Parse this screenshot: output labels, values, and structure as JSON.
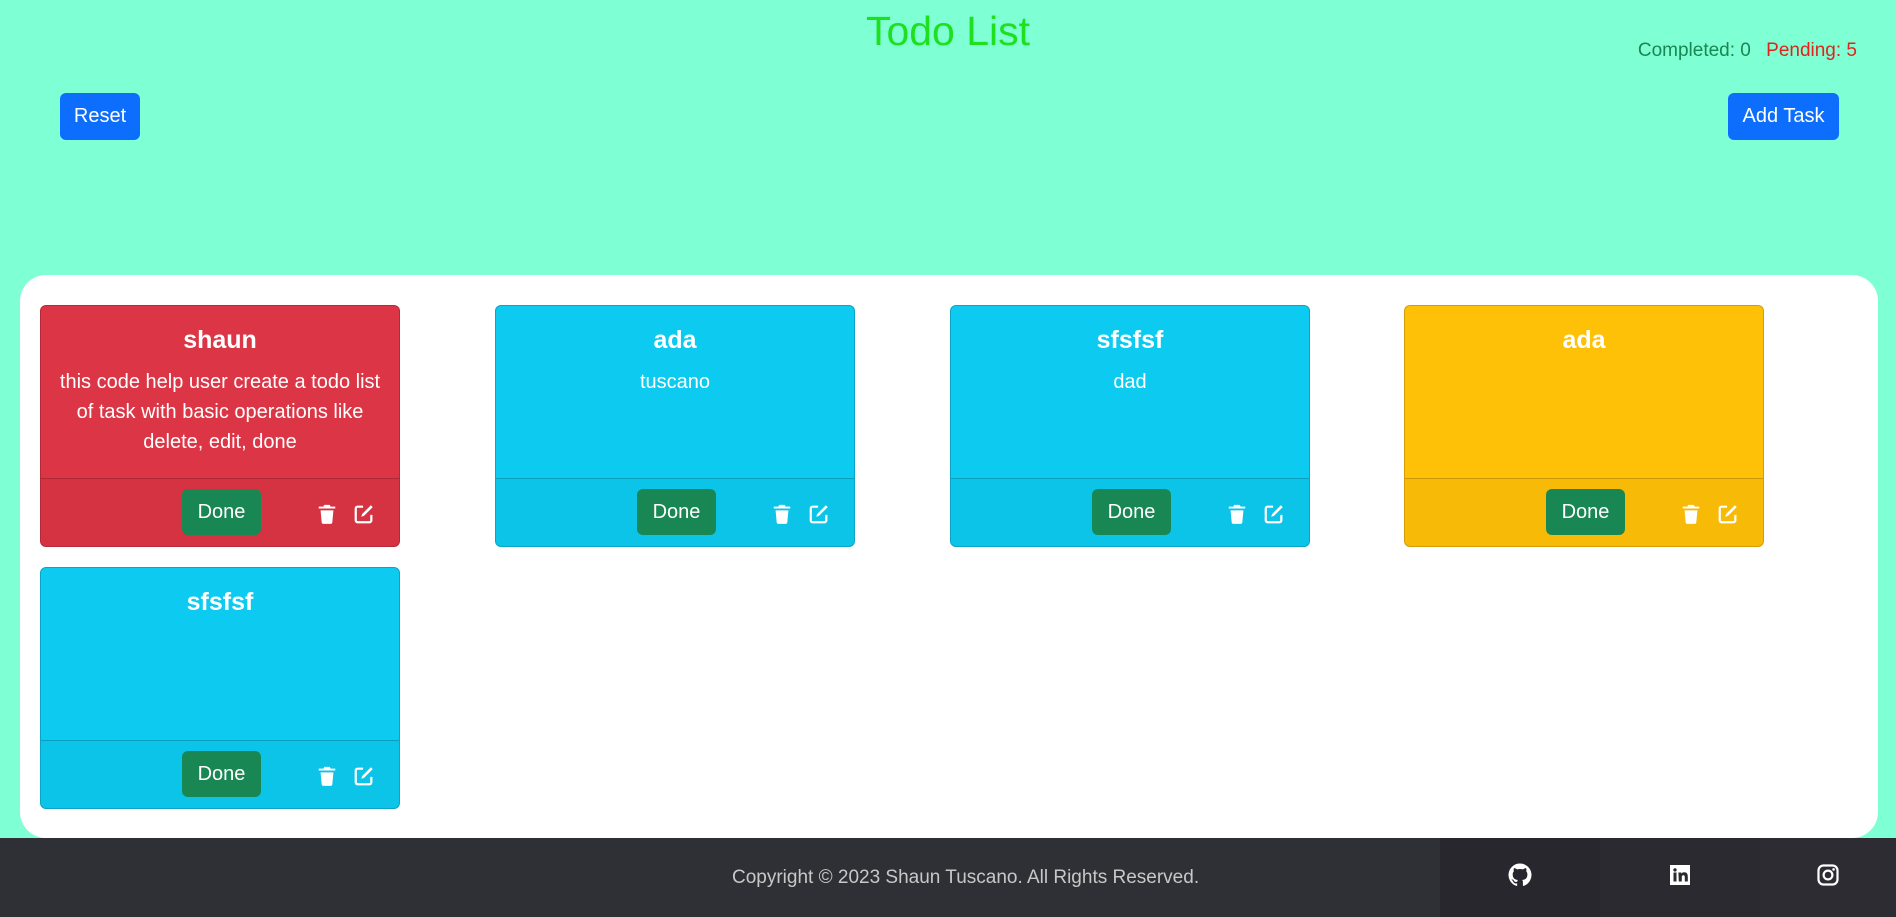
{
  "header": {
    "title": "Todo List",
    "completed_label": "Completed: 0",
    "pending_label": "Pending: 5",
    "reset_label": "Reset",
    "add_label": "Add Task"
  },
  "tasks": [
    {
      "title": "shaun",
      "description": "this code help user create a todo list of task with basic operations like delete, edit, done",
      "color": "#dc3545",
      "done_label": "Done"
    },
    {
      "title": "ada",
      "description": "tuscano",
      "color": "#0dcaf0",
      "done_label": "Done"
    },
    {
      "title": "sfsfsf",
      "description": "dad",
      "color": "#0dcaf0",
      "done_label": "Done"
    },
    {
      "title": "ada",
      "description": "",
      "color": "#ffc107",
      "done_label": "Done"
    },
    {
      "title": "sfsfsf",
      "description": "",
      "color": "#0dcaf0",
      "done_label": "Done"
    }
  ],
  "footer": {
    "copyright": "Copyright © 2023 Shaun Tuscano. All Rights Reserved.",
    "social": [
      "github-icon",
      "linkedin-icon",
      "instagram-icon"
    ]
  },
  "colors": {
    "background": "#7fffd4",
    "title": "#1fe01f",
    "primary": "#0d6efd",
    "success": "#198754",
    "pending": "#e3221c"
  }
}
